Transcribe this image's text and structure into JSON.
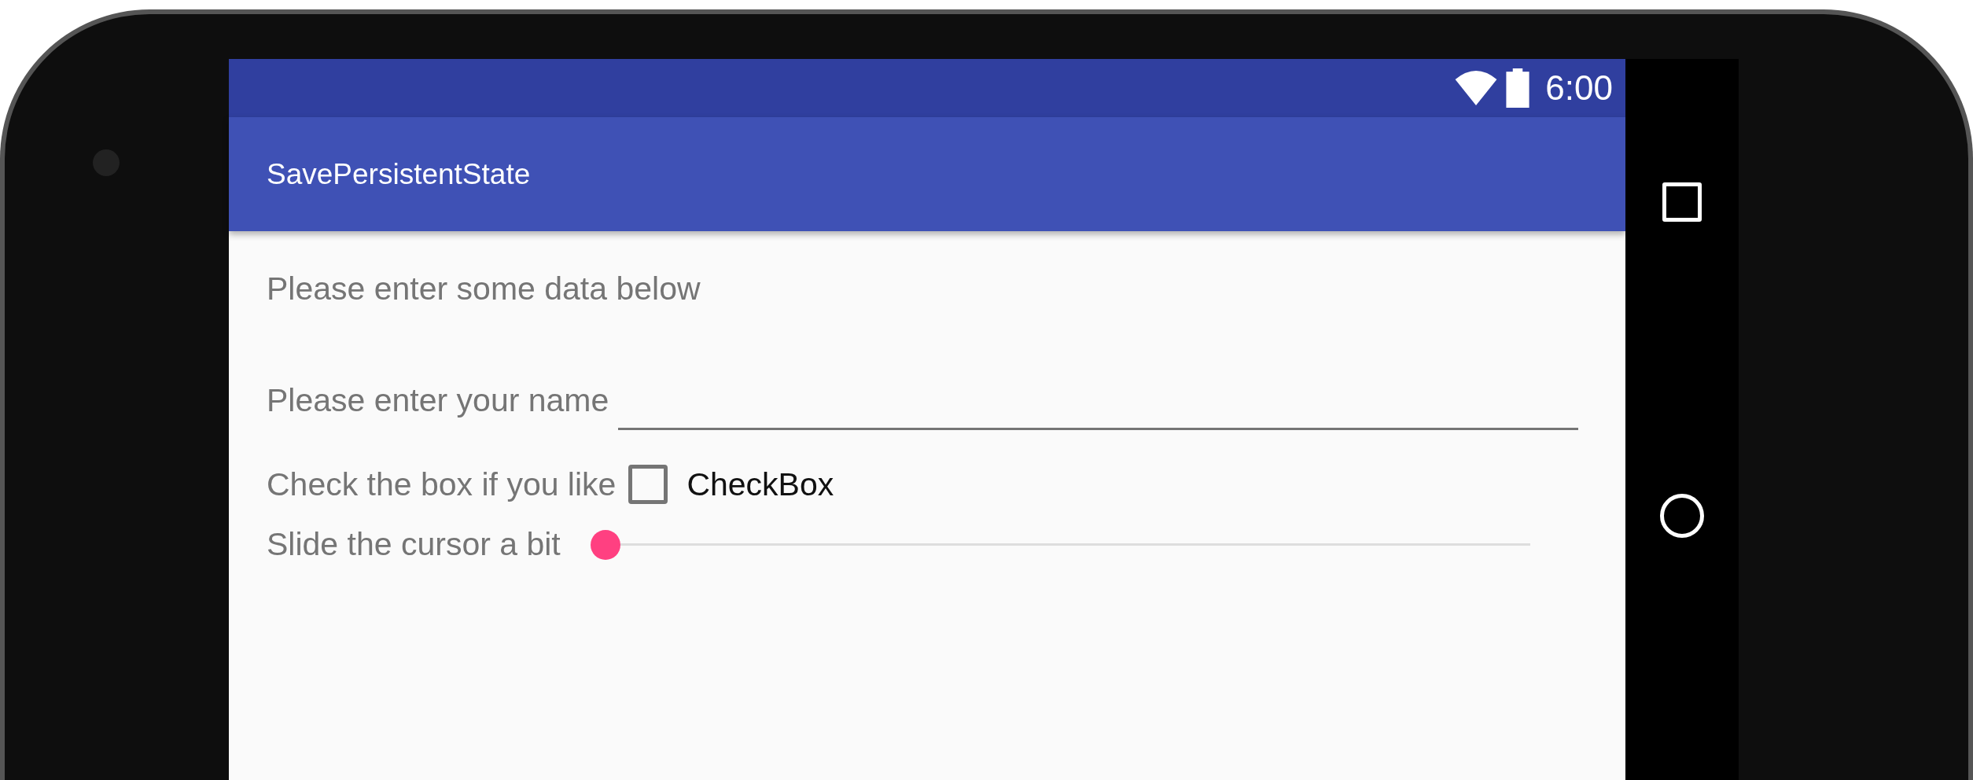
{
  "status_bar": {
    "time": "6:00"
  },
  "app_bar": {
    "title": "SavePersistentState"
  },
  "content": {
    "intro": "Please enter some data below",
    "name_row": {
      "label": "Please enter your name"
    },
    "checkbox_row": {
      "label": "Check the box if you like",
      "checkbox_text": "CheckBox",
      "checked": false
    },
    "slider_row": {
      "label": "Slide the cursor a bit",
      "level": 0
    }
  }
}
